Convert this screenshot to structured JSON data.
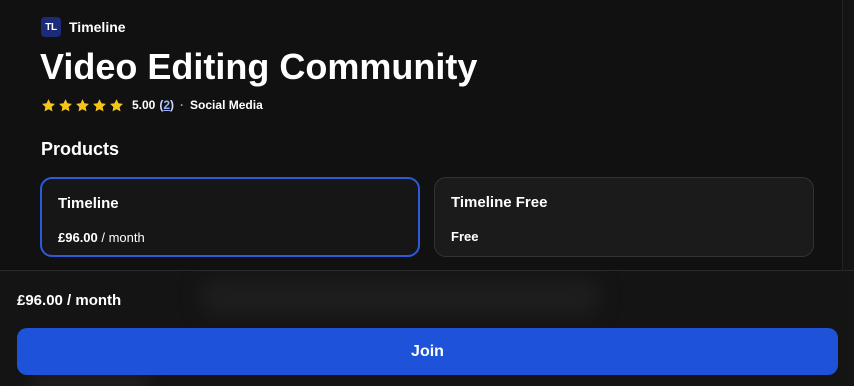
{
  "brand": {
    "logo_text": "TL",
    "name": "Timeline",
    "logo_color": "#1c2a78"
  },
  "title": "Video Editing Community",
  "rating": {
    "value": "5.00",
    "stars": 5,
    "count_open": "(",
    "count": "2",
    "count_close": ")",
    "separator": "·",
    "category": "Social Media",
    "star_color": "#f5c518"
  },
  "products": {
    "heading": "Products",
    "items": [
      {
        "name": "Timeline",
        "price": "£96.00",
        "period": " / month",
        "selected": true
      },
      {
        "name": "Timeline Free",
        "price": "Free",
        "period": "",
        "selected": false
      }
    ]
  },
  "footer": {
    "price_label": "£96.00 / month",
    "join_label": "Join",
    "accent_color": "#1d52d9"
  },
  "icons": {
    "star": "star-icon"
  }
}
